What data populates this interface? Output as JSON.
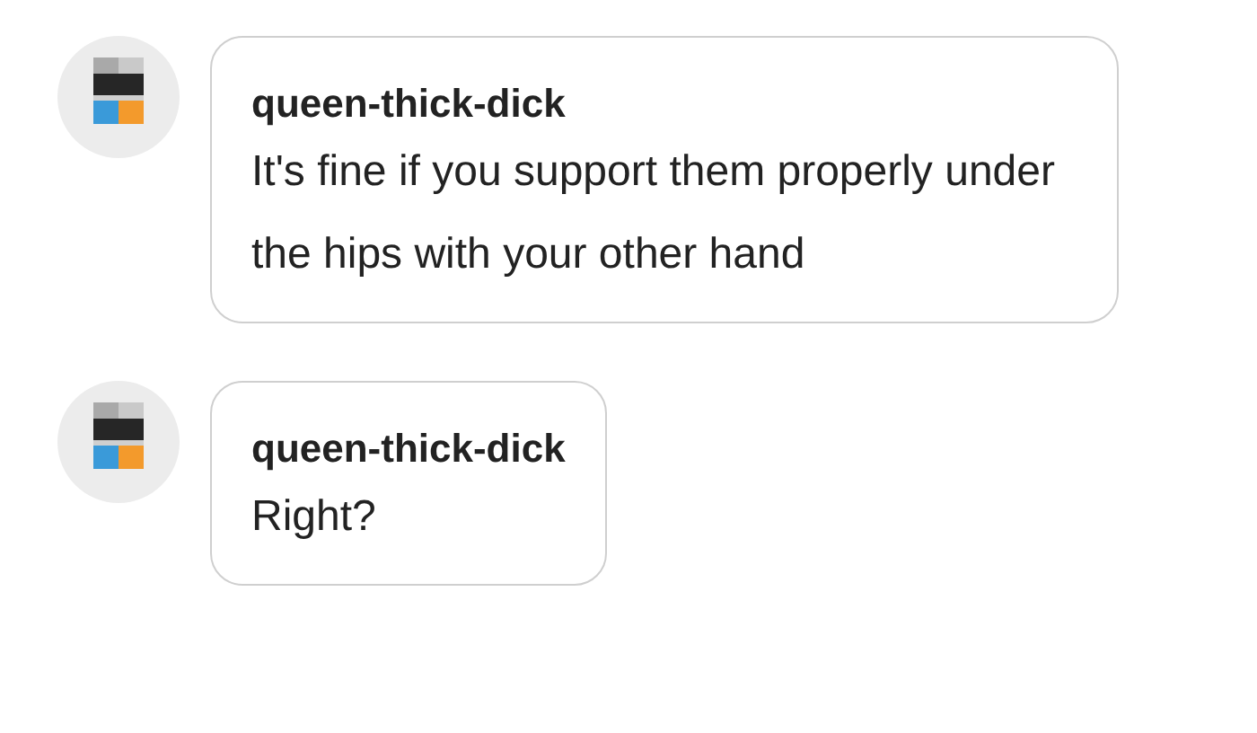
{
  "replies": [
    {
      "username": "queen-thick-dick",
      "text": "It's fine if you support them properly under the hips with your other hand"
    },
    {
      "username": "queen-thick-dick",
      "text": "Right?"
    }
  ]
}
